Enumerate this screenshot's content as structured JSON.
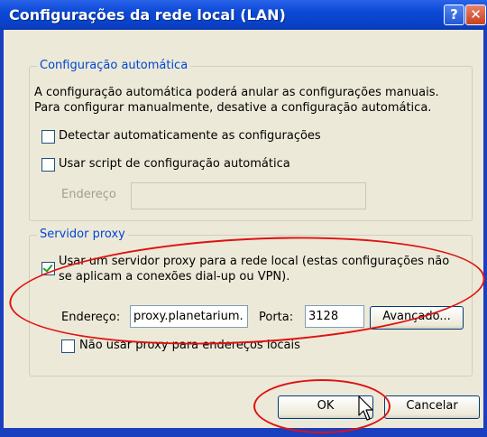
{
  "window": {
    "title": "Configurações da rede local (LAN)",
    "help_label": "?",
    "close_label": "✕"
  },
  "auto_config": {
    "legend": "Configuração automática",
    "description_line1": "A configuração automática poderá anular as configurações manuais.",
    "description_line2": "Para configurar manualmente, desative a configuração automática.",
    "detect_label": "Detectar automaticamente as configurações",
    "detect_checked": false,
    "script_label": "Usar script de configuração automática",
    "script_checked": false,
    "address_label": "Endereço",
    "address_value": ""
  },
  "proxy": {
    "legend": "Servidor proxy",
    "use_proxy_line1": "Usar um servidor proxy para a rede local (estas configurações não",
    "use_proxy_line2": "se aplicam a conexões dial-up ou VPN).",
    "use_proxy_checked": true,
    "address_label": "Endereço:",
    "address_value": "proxy.planetarium.",
    "port_label": "Porta:",
    "port_value": "3128",
    "advanced_label": "Avançado...",
    "bypass_label": "Não usar proxy para endereços locais",
    "bypass_checked": false
  },
  "buttons": {
    "ok_label": "OK",
    "cancel_label": "Cancelar"
  },
  "colors": {
    "title_bar": "#0a49d6",
    "legend_text": "#0046d5",
    "annotation": "#e01212",
    "dialog_bg": "#ece9d8"
  }
}
